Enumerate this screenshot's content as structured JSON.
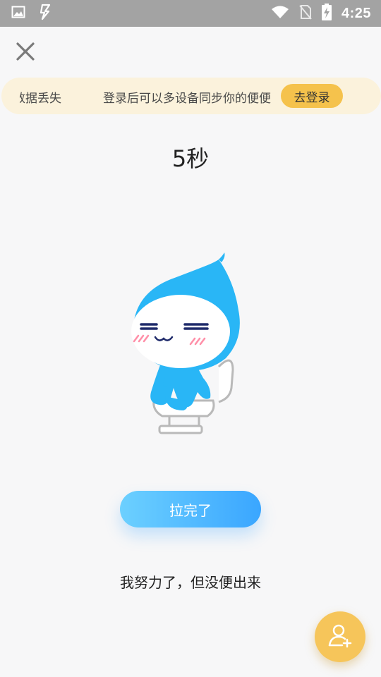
{
  "status_bar": {
    "time": "4:25",
    "icons": [
      "image-icon",
      "lightning-icon",
      "wifi-icon",
      "no-sim-icon",
      "battery-charging-icon"
    ]
  },
  "close_icon": "close-icon",
  "banner": {
    "text_left": "的数据丢失",
    "text_right": "登录后可以多设备同步你的便便",
    "login_label": "去登录"
  },
  "timer": {
    "value": "5秒"
  },
  "mascot_icon": "water-drop-mascot-on-toilet",
  "done_button": {
    "label": "拉完了"
  },
  "fail_link": {
    "label": "我努力了，但没便出来"
  },
  "fab": {
    "icon": "add-user-icon"
  },
  "colors": {
    "accent_blue": "#3aa6ff",
    "accent_blue_light": "#6cd0ff",
    "banner_bg": "#fbf2dc",
    "login_button": "#f5c24c",
    "fab": "#f6c55a",
    "status_bar": "#a3a3a3"
  }
}
